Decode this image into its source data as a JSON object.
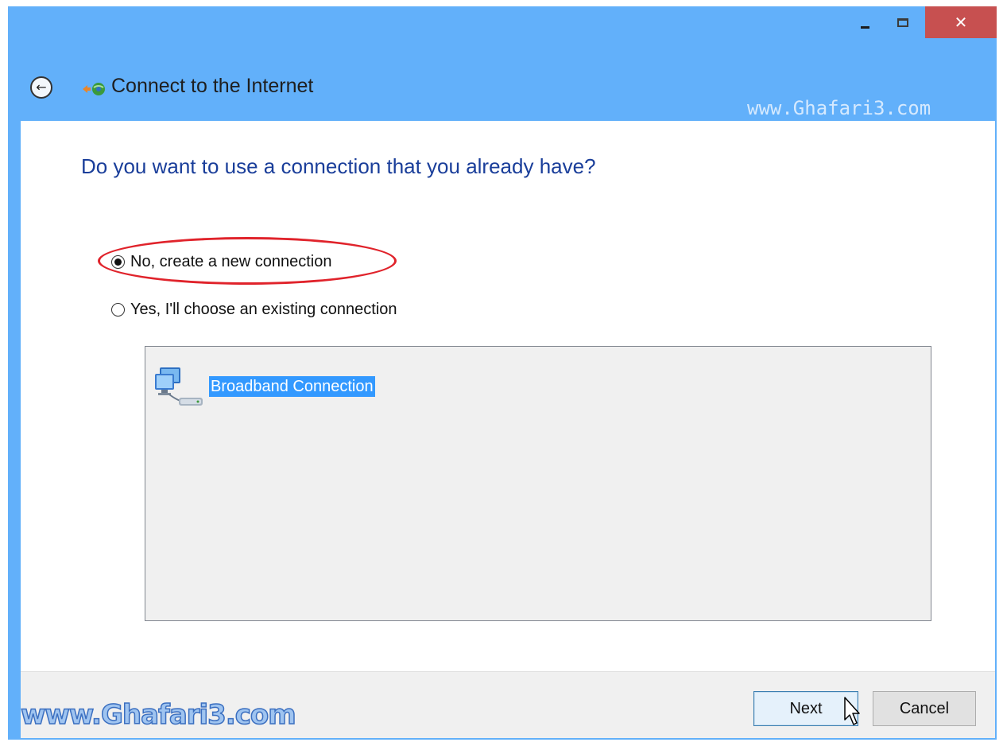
{
  "window": {
    "title_controls": {
      "minimize": "minimize",
      "maximize": "maximize",
      "close": "✕"
    }
  },
  "header": {
    "title": "Connect to the Internet",
    "watermark": "www.Ghafari3.com"
  },
  "content": {
    "question": "Do you want to use a connection that you already have?",
    "options": [
      {
        "label": "No, create a new connection",
        "selected": true
      },
      {
        "label": "Yes, I'll choose an existing connection",
        "selected": false
      }
    ],
    "connections": [
      {
        "label": "Broadband Connection",
        "icon": "broadband-connection-icon",
        "selected": true
      }
    ]
  },
  "footer": {
    "watermark": "www.Ghafari3.com",
    "next_label": "Next",
    "cancel_label": "Cancel"
  },
  "colors": {
    "title_bar": "#62b0fa",
    "close_button": "#c75050",
    "question_text": "#1a3e9a",
    "selection": "#3399ff",
    "annotation": "#e0232b"
  }
}
